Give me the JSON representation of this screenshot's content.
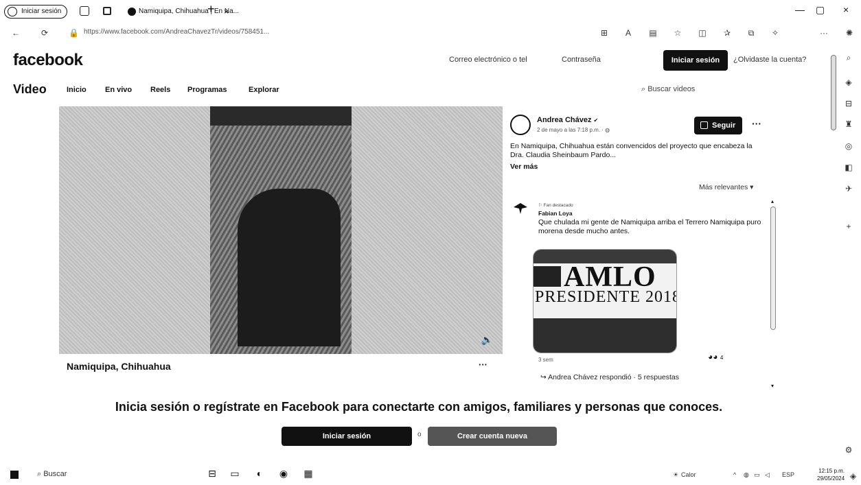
{
  "browser": {
    "profile_label": "Iniciar sesión",
    "tab_title": "Namiquipa, Chihuahua | En Na...",
    "tab_close": "×",
    "new_tab": "+",
    "url": "https://www.facebook.com/AndreaChavezTr/videos/758451...",
    "window_min": "—",
    "window_max": "▢",
    "window_close": "×",
    "more": "···"
  },
  "header": {
    "logo": "facebook",
    "email_placeholder": "Correo electrónico o tel",
    "password_placeholder": "Contraseña",
    "login_button": "Iniciar sesión",
    "forgot_link": "¿Olvidaste la cuenta?"
  },
  "video_nav": {
    "title": "Video",
    "items": [
      "Inicio",
      "En vivo",
      "Reels",
      "Programas",
      "Explorar"
    ],
    "search_placeholder": "Buscar videos"
  },
  "video": {
    "location": "Namiquipa, Chihuahua",
    "more": "···"
  },
  "post": {
    "author": "Andrea Chávez",
    "verified": "✔",
    "date": "2 de mayo a las 7:18 p.m. · ",
    "follow_label": "Seguir",
    "more": "···",
    "text": "En Namiquipa, Chihuahua están convencidos del proyecto que encabeza la Dra. Claudia Sheinbaum Pardo...",
    "see_more": "Ver más"
  },
  "comments": {
    "sort_label": "Más relevantes",
    "sort_arrow": "▾",
    "items": [
      {
        "tag": "⚐ Fan destacado",
        "name": "Fabian Loya",
        "text": "Que chulada mi gente de Namiquipa arriba el Terrero Namiquipa puro morena desde mucho antes.",
        "image_title": "AMLO",
        "image_subtitle": "PRESIDENTE 2018",
        "time_ago": "3 sem",
        "reaction_count": "4",
        "reply_summary": "Andrea Chávez respondió · 5 respuestas"
      }
    ]
  },
  "banner": {
    "text": "Inicia sesión o regístrate en Facebook para conectarte con amigos, familiares y personas que conoces.",
    "login_label": "Iniciar sesión",
    "or": "o",
    "create_label": "Crear cuenta nueva"
  },
  "taskbar": {
    "search": "Buscar",
    "weather": "Calor",
    "lang": "ESP",
    "time": "12:15 p.m.",
    "date": "29/05/2024"
  }
}
